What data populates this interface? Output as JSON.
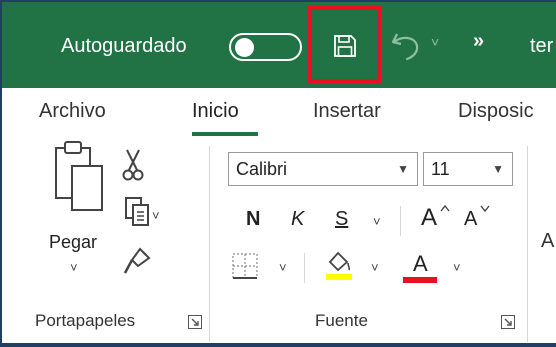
{
  "titlebar": {
    "autosave_label": "Autoguardado",
    "autosave_on": false,
    "more_label": "»",
    "title_text": "ter",
    "bg_color": "#217346",
    "highlight_color": "#e81123"
  },
  "tabs": [
    {
      "label": "Archivo",
      "active": false
    },
    {
      "label": "Inicio",
      "active": true
    },
    {
      "label": "Insertar",
      "active": false
    },
    {
      "label": "Disposic",
      "active": false
    }
  ],
  "clipboard": {
    "paste_label": "Pegar",
    "group_label": "Portapapeles"
  },
  "font": {
    "font_name": "Calibri",
    "font_size": "11",
    "bold_label": "N",
    "italic_label": "K",
    "underline_label": "S",
    "grow_label": "A",
    "shrink_label": "A",
    "font_color_label": "A",
    "highlight_color": "#ffff00",
    "font_color": "#e81123",
    "group_label": "Fuente"
  },
  "alignment": {
    "edge_label": "A"
  }
}
